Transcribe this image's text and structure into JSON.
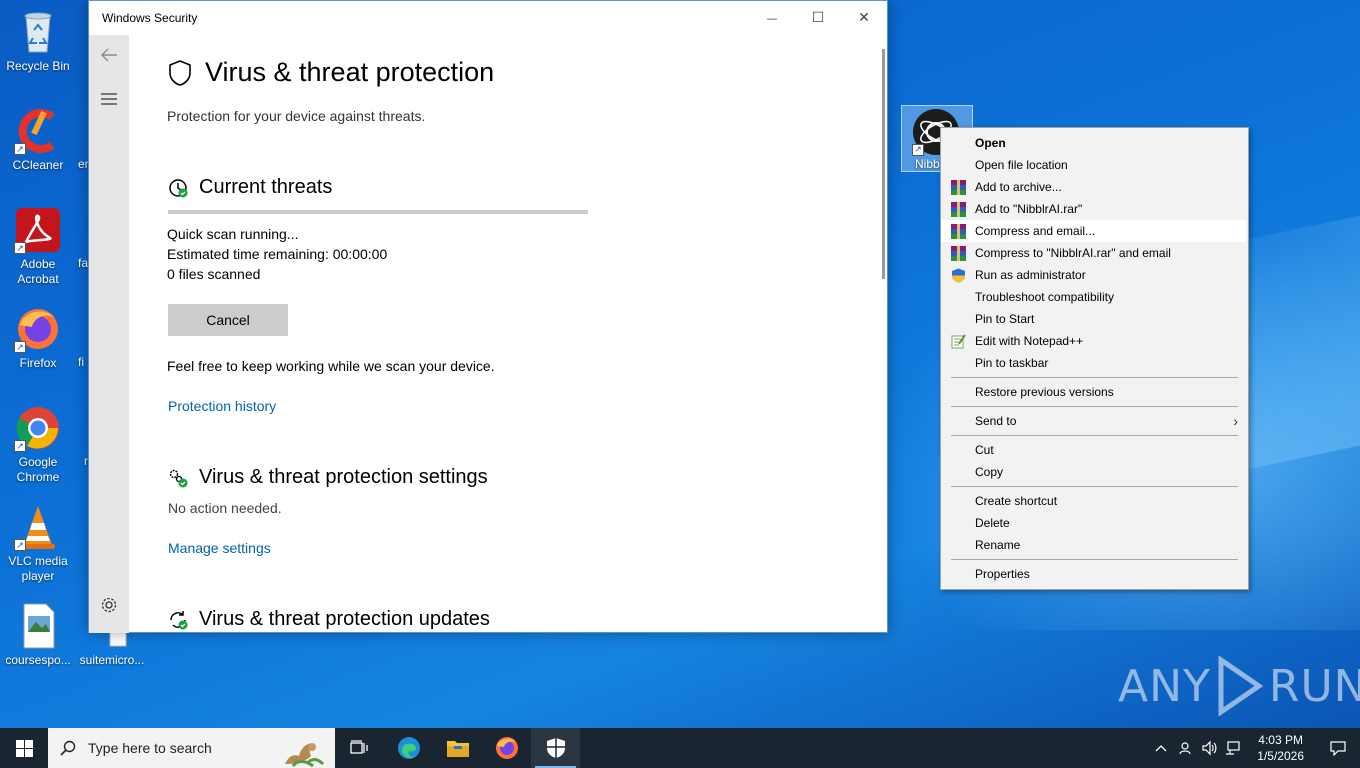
{
  "desktop": {
    "icons": [
      {
        "label": "Recycle Bin"
      },
      {
        "label": "CCleaner"
      },
      {
        "label": "Adobe Acrobat"
      },
      {
        "label": "Firefox"
      },
      {
        "label": "Google Chrome"
      },
      {
        "label": "VLC media player"
      },
      {
        "label": "coursespo..."
      },
      {
        "label": "suitemicro..."
      }
    ],
    "partial_labels": [
      "en",
      "fa",
      "fi",
      "r"
    ],
    "selected_icon_label": "Nibb"
  },
  "window": {
    "title": "Windows Security",
    "minimize": "—",
    "maximize": "☐",
    "close": "✕",
    "page_title": "Virus & threat protection",
    "page_subtitle": "Protection for your device against threats.",
    "current_threats": {
      "heading": "Current threats",
      "status": "Quick scan running...",
      "time_remaining": "Estimated time remaining:  00:00:00",
      "files_scanned": "0  files scanned",
      "cancel_label": "Cancel",
      "info": "Feel free to keep working while we scan your device.",
      "history_link": "Protection history"
    },
    "settings": {
      "heading": "Virus & threat protection settings",
      "status": "No action needed.",
      "link": "Manage settings"
    },
    "updates": {
      "heading": "Virus & threat protection updates"
    }
  },
  "context_menu": {
    "items": [
      {
        "label": "Open"
      },
      {
        "label": "Open file location"
      },
      {
        "label": "Add to archive..."
      },
      {
        "label": "Add to \"NibblrAI.rar\""
      },
      {
        "label": "Compress and email..."
      },
      {
        "label": "Compress to \"NibblrAI.rar\" and email"
      },
      {
        "label": "Run as administrator"
      },
      {
        "label": "Troubleshoot compatibility"
      },
      {
        "label": "Pin to Start"
      },
      {
        "label": "Edit with Notepad++"
      },
      {
        "label": "Pin to taskbar"
      },
      {
        "label": "Restore previous versions"
      },
      {
        "label": "Send to"
      },
      {
        "label": "Cut"
      },
      {
        "label": "Copy"
      },
      {
        "label": "Create shortcut"
      },
      {
        "label": "Delete"
      },
      {
        "label": "Rename"
      },
      {
        "label": "Properties"
      }
    ]
  },
  "taskbar": {
    "search_placeholder": "Type here to search",
    "time": "4:03 PM",
    "date": "1/5/2026"
  },
  "watermark": {
    "left": "ANY",
    "right": "RUN"
  }
}
